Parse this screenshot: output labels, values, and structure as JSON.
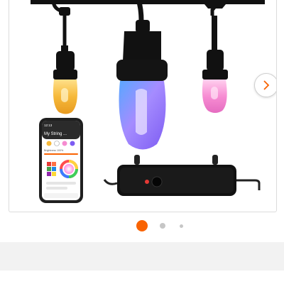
{
  "product_gallery": {
    "image_alt": "String lights with app and controller",
    "phone_screen": {
      "title": "My String ...",
      "time": "12:13",
      "brightness_label": "Brightness 100%"
    },
    "next_button_icon": "chevron-right-icon",
    "carousel": {
      "total_slides": 3,
      "active_index": 0,
      "active_color": "#f96302",
      "inactive_color": "#c6c6c6"
    }
  },
  "colors": {
    "accent": "#f96302",
    "band": "#f2f2f2"
  }
}
